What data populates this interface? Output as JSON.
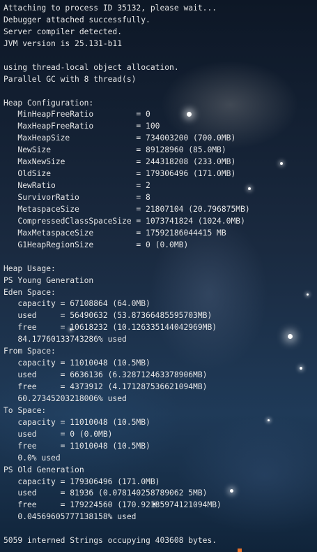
{
  "terminal": {
    "lines": [
      "Attaching to process ID 35132, please wait...",
      "Debugger attached successfully.",
      "Server compiler detected.",
      "JVM version is 25.131-b11",
      "",
      "using thread-local object allocation.",
      "Parallel GC with 8 thread(s)",
      "",
      "Heap Configuration:",
      "   MinHeapFreeRatio         = 0",
      "   MaxHeapFreeRatio         = 100",
      "   MaxHeapSize              = 734003200 (700.0MB)",
      "   NewSize                  = 89128960 (85.0MB)",
      "   MaxNewSize               = 244318208 (233.0MB)",
      "   OldSize                  = 179306496 (171.0MB)",
      "   NewRatio                 = 2",
      "   SurvivorRatio            = 8",
      "   MetaspaceSize            = 21807104 (20.796875MB)",
      "   CompressedClassSpaceSize = 1073741824 (1024.0MB)",
      "   MaxMetaspaceSize         = 17592186044415 MB",
      "   G1HeapRegionSize         = 0 (0.0MB)",
      "",
      "Heap Usage:",
      "PS Young Generation",
      "Eden Space:",
      "   capacity = 67108864 (64.0MB)",
      "   used     = 56490632 (53.87366485595703MB)",
      "   free     = 10618232 (10.126335144042969MB)",
      "   84.17760133743286% used",
      "From Space:",
      "   capacity = 11010048 (10.5MB)",
      "   used     = 6636136 (6.328712463378906MB)",
      "   free     = 4373912 (4.171287536621094MB)",
      "   60.27345203218006% used",
      "To Space:",
      "   capacity = 11010048 (10.5MB)",
      "   used     = 0 (0.0MB)",
      "   free     = 11010048 (10.5MB)",
      "   0.0% used",
      "PS Old Generation",
      "   capacity = 179306496 (171.0MB)",
      "   used     = 81936 (0.078140258789062 5MB)",
      "   free     = 179224560 (170.92185974121094MB)",
      "   0.04569605777138158% used",
      "",
      "5059 interned Strings occupying 403608 bytes."
    ]
  }
}
